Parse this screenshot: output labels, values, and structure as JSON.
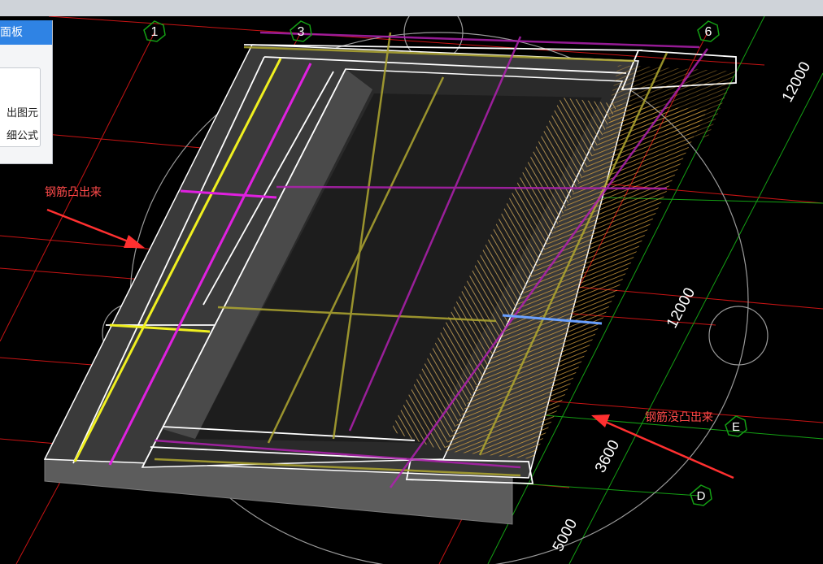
{
  "panel": {
    "title": "面板",
    "items": [
      "出图元",
      "细公式"
    ]
  },
  "annotations": {
    "protruding": "钢筋凸出来",
    "not_protruding": "钢筋没凸出来"
  },
  "axis_labels": {
    "col_1": "1",
    "col_3": "3",
    "col_6": "6",
    "row_E": "E",
    "row_D": "D"
  },
  "dimensions": {
    "dim_top_right": "12000",
    "dim_mid_right": "12000",
    "dim_3600": "3600",
    "dim_5000": "5000"
  },
  "colors": {
    "grid_red": "#c81414",
    "grid_green": "#14a014",
    "rebar_yellow": "#f0f020",
    "rebar_magenta": "#e020e0",
    "rebar_tan": "#d8b060",
    "annotation": "#ff4a4a",
    "panel_header": "#2f83e4"
  }
}
